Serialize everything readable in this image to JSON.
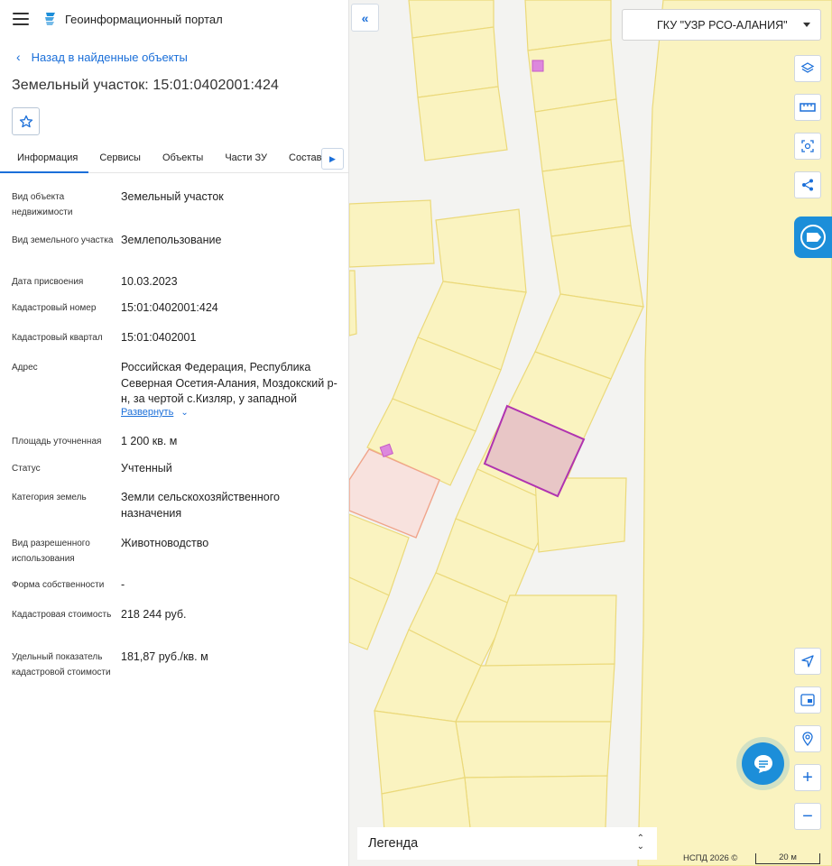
{
  "header": {
    "portal_title": "Геоинформационный портал"
  },
  "nav": {
    "back_label": "Назад в найденные объекты"
  },
  "object": {
    "title": "Земельный участок: 15:01:0402001:424"
  },
  "tabs": [
    {
      "label": "Информация",
      "active": true
    },
    {
      "label": "Сервисы"
    },
    {
      "label": "Объекты"
    },
    {
      "label": "Части ЗУ"
    },
    {
      "label": "Состав"
    }
  ],
  "info": [
    {
      "label": "Вид объекта недвижимости",
      "value": "Земельный участок"
    },
    {
      "label": "Вид земельного участка",
      "value": "Землепользование"
    },
    {
      "label": "Дата присвоения",
      "value": "10.03.2023"
    },
    {
      "label": "Кадастровый номер",
      "value": "15:01:0402001:424"
    },
    {
      "label": "Кадастровый квартал",
      "value": "15:01:0402001"
    },
    {
      "label": "Адрес",
      "value": "Российская Федерация, Республика Северная Осетия-Алания, Моздокский р-н, за чертой с.Кизляр, у западной",
      "expand_label": "Развернуть"
    },
    {
      "label": "Площадь уточненная",
      "value": "1 200 кв. м"
    },
    {
      "label": "Статус",
      "value": "Учтенный"
    },
    {
      "label": "Категория земель",
      "value": "Земли сельскохозяйственного назначения"
    },
    {
      "label": "Вид разрешенного использования",
      "value": "Животноводство"
    },
    {
      "label": "Форма собственности",
      "value": "-"
    },
    {
      "label": "Кадастровая стоимость",
      "value": "218 244 руб."
    },
    {
      "label": "Удельный показатель кадастровой стоимости",
      "value": "181,87 руб./кв. м"
    }
  ],
  "map": {
    "org_select": "ГКУ \"УЗР РСО-АЛАНИЯ\"",
    "legend_label": "Легенда",
    "attribution": "НСПД 2026 ©",
    "scale_label": "20 м",
    "colors": {
      "parcel_fill": "#faf3c0",
      "parcel_stroke": "#ebd97a",
      "selected_stroke": "#b033b0",
      "selected_fill": "#e8c6c6",
      "accent": "#1c8ed9"
    }
  }
}
